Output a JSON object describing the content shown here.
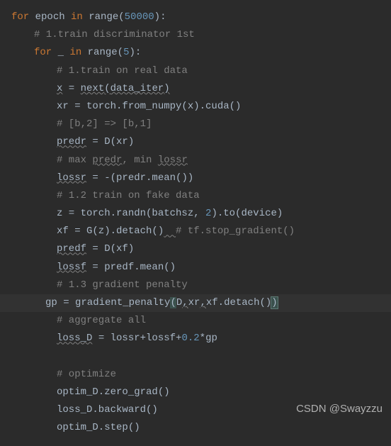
{
  "lines": {
    "l1_for": "for",
    "l1_epoch": " epoch ",
    "l1_in": "in",
    "l1_range": " range(",
    "l1_num": "50000",
    "l1_end": "):",
    "l2_comment": "# 1.train discriminator 1st",
    "l3_for": "for",
    "l3_under": " _ ",
    "l3_in": "in",
    "l3_range": " range(",
    "l3_num": "5",
    "l3_end": "):",
    "l4_comment": "# 1.train on real data",
    "l5_x": "x",
    "l5_eq": " = ",
    "l5_next": "next",
    "l5_open": "(",
    "l5_iter": "data_iter",
    "l5_close": ")",
    "l6_xr": "xr = torch.from_numpy(x).cuda()",
    "l7_comment": "# [b,2] => [b,1]",
    "l8_predr": "predr",
    "l8_rest": " = D(xr)",
    "l9_c1": "# max ",
    "l9_predr": "predr",
    "l9_c2": ", min ",
    "l9_lossr": "lossr",
    "l10_lossr": "lossr",
    "l10_rest": " = -(predr.mean())",
    "l11_comment": "# 1.2 train on fake data",
    "l12_a": "z = torch.randn(batchsz, ",
    "l12_num": "2",
    "l12_b": ").to(device)",
    "l13_a": "xf = G(z).detach()",
    "l13_sep": "  ",
    "l13_comment": "# tf.stop_gradient()",
    "l14_predf": "predf",
    "l14_rest": " = D(xf)",
    "l15_lossf": "lossf",
    "l15_rest": " = predf.mean()",
    "l16_comment": "# 1.3 gradient penalty",
    "l17_gp": "gp = gradient_penalty",
    "l17_open": "(",
    "l17_d": "D",
    "l17_c1": ",",
    "l17_xr": "xr",
    "l17_c2": ",",
    "l17_xf": "xf.detach(",
    "l17_close1": ")",
    "l17_close2": ")",
    "l18_comment": "# aggregate all",
    "l19_lossd": "loss_D",
    "l19_a": " = lossr+lossf+",
    "l19_num": "0.2",
    "l19_b": "*gp",
    "l20_blank": "",
    "l21_comment": "# optimize",
    "l22": "optim_D.zero_grad()",
    "l23": "loss_D.backward()",
    "l24": "optim_D.step()"
  },
  "watermark": "CSDN @Swayzzu"
}
